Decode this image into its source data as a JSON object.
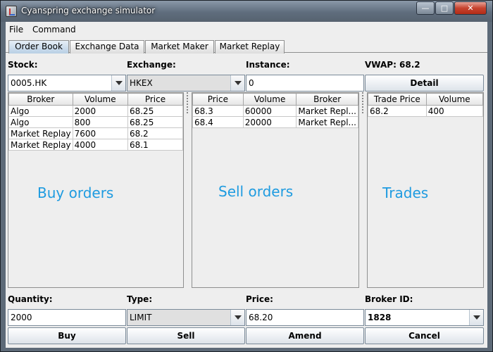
{
  "window": {
    "title": "Cyanspring exchange simulator"
  },
  "menu": [
    "File",
    "Command"
  ],
  "tabs": [
    "Order Book",
    "Exchange Data",
    "Market Maker",
    "Market Replay"
  ],
  "top_form": {
    "stock_label": "Stock:",
    "stock_value": "0005.HK",
    "exchange_label": "Exchange:",
    "exchange_value": "HKEX",
    "instance_label": "Instance:",
    "instance_value": "0",
    "vwap_label": "VWAP: 68.2",
    "detail_button": "Detail"
  },
  "buy_table": {
    "headers": [
      "Broker",
      "Volume",
      "Price"
    ],
    "rows": [
      [
        "Algo",
        "2000",
        "68.25"
      ],
      [
        "Algo",
        "800",
        "68.25"
      ],
      [
        "Market Replay",
        "7600",
        "68.2"
      ],
      [
        "Market Replay",
        "4000",
        "68.1"
      ]
    ],
    "overlay": "Buy orders"
  },
  "sell_table": {
    "headers": [
      "Price",
      "Volume",
      "Broker"
    ],
    "rows": [
      [
        "68.3",
        "60000",
        "Market Repl..."
      ],
      [
        "68.4",
        "20000",
        "Market Repl..."
      ]
    ],
    "overlay": "Sell orders"
  },
  "trade_table": {
    "headers": [
      "Trade Price",
      "Volume"
    ],
    "rows": [
      [
        "68.2",
        "400"
      ]
    ],
    "overlay": "Trades"
  },
  "bottom_form": {
    "quantity_label": "Quantity:",
    "quantity_value": "2000",
    "type_label": "Type:",
    "type_value": "LIMIT",
    "price_label": "Price:",
    "price_value": "68.20",
    "broker_label": "Broker ID:",
    "broker_value": "1828"
  },
  "actions": {
    "buy": "Buy",
    "sell": "Sell",
    "amend": "Amend",
    "cancel": "Cancel"
  }
}
